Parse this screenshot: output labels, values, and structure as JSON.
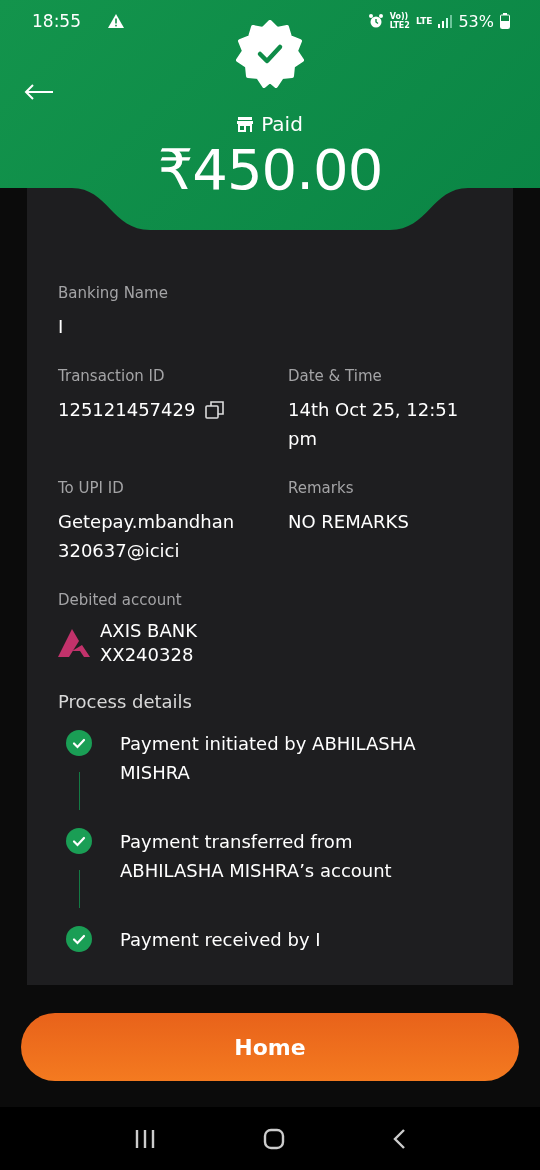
{
  "status_bar": {
    "time": "18:55",
    "volte": "Vo))",
    "network_2": "LTE2",
    "network": "LTE",
    "battery": "53%"
  },
  "header": {
    "status": "Paid",
    "amount": "₹450.00"
  },
  "details": [
    {
      "label": "Banking Name",
      "value": "I",
      "copy": false,
      "wide": true
    },
    {
      "label": "Transaction ID",
      "value": "125121457429",
      "copy": true,
      "wide": false
    },
    {
      "label": "Date & Time",
      "value": "14th Oct 25, 12:51 pm",
      "copy": false,
      "wide": false
    },
    {
      "label": "To UPI ID",
      "value": "Getepay.mbandhan320637@icici",
      "copy": false,
      "wide": false
    },
    {
      "label": "Remarks",
      "value": "NO REMARKS",
      "copy": false,
      "wide": false
    }
  ],
  "debited_account": {
    "label": "Debited account",
    "bank": "AXIS BANK",
    "account": "XX240328"
  },
  "process": {
    "title": "Process details",
    "steps": [
      {
        "text": "Payment initiated by ABHILASHA MISHRA",
        "done": true
      },
      {
        "text": "Payment transferred from ABHILASHA MISHRA’s account",
        "done": true
      },
      {
        "text": "Payment received by I",
        "done": true
      }
    ]
  },
  "home_button": "Home"
}
